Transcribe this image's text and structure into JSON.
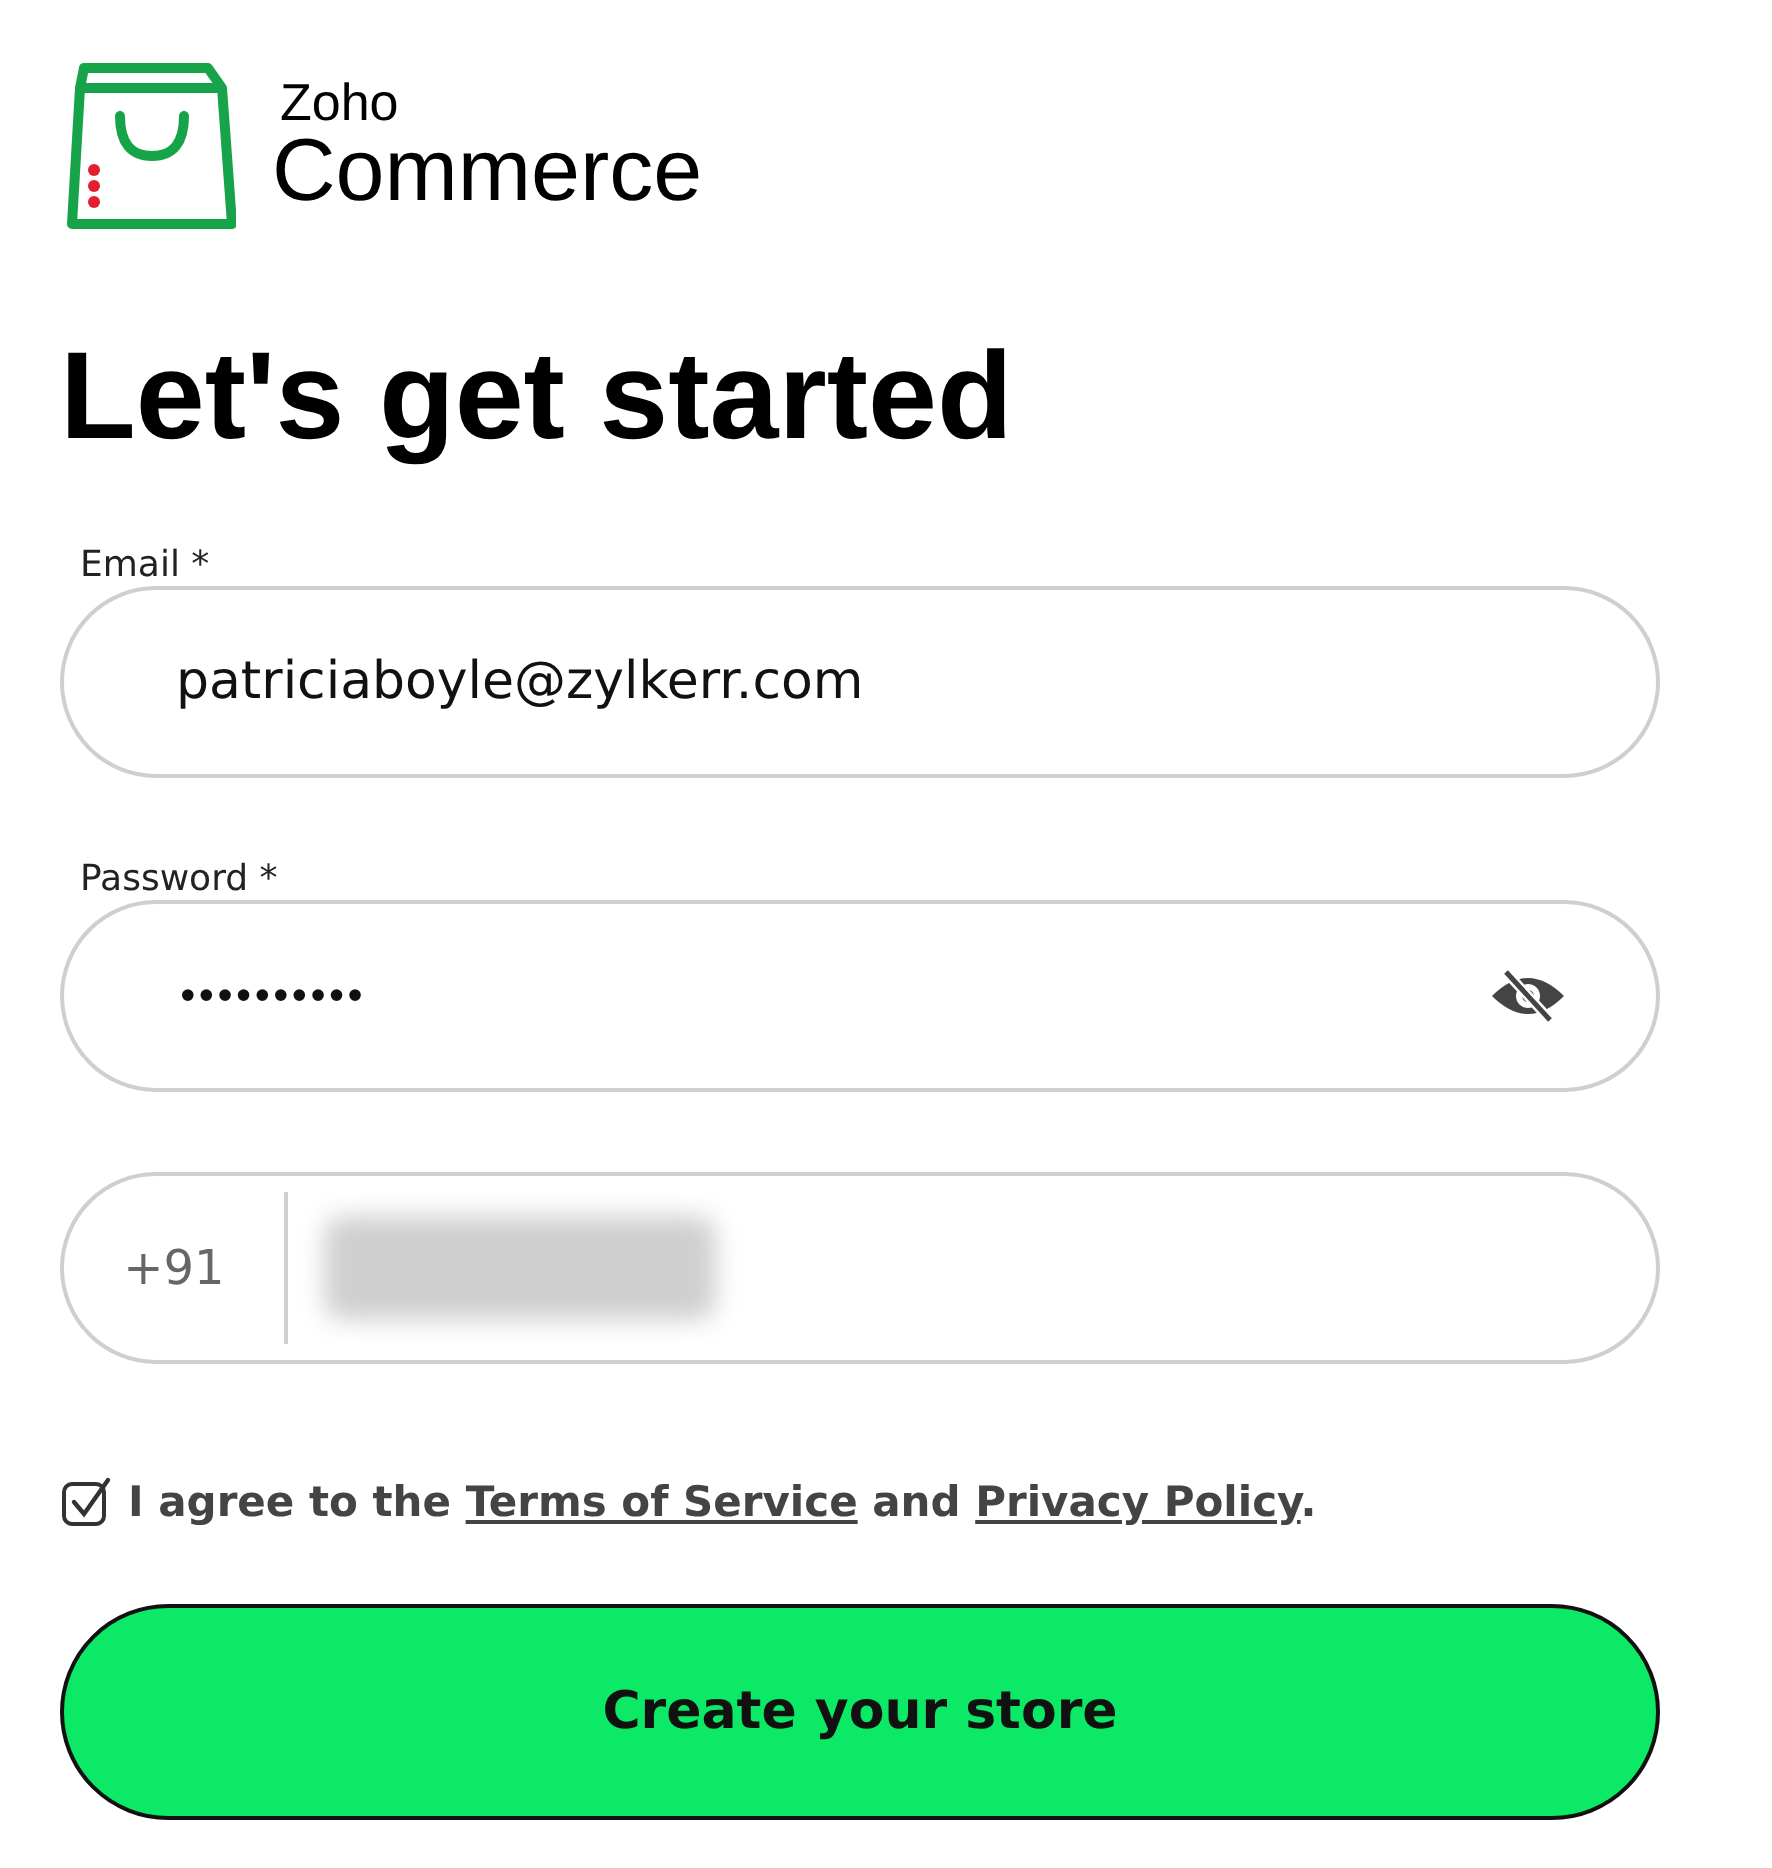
{
  "logo": {
    "brand": "Zoho",
    "product": "Commerce"
  },
  "heading": "Let's get started",
  "fields": [
    {
      "kind": "text",
      "label": "Email *",
      "value": "patriciaboyle@zylkerr.com"
    },
    {
      "kind": "password",
      "label": "Password *",
      "value": "••••••••••",
      "revealed": false
    },
    {
      "kind": "phone",
      "prefix": "+91",
      "redacted": true
    }
  ],
  "agreement": {
    "checked": true,
    "parts": [
      {
        "kind": "text",
        "text": "I agree to the "
      },
      {
        "kind": "link",
        "text": "Terms of Service"
      },
      {
        "kind": "text",
        "text": " and "
      },
      {
        "kind": "link",
        "text": "Privacy Policy"
      },
      {
        "kind": "text",
        "text": "."
      }
    ]
  },
  "submit": "Create your store"
}
